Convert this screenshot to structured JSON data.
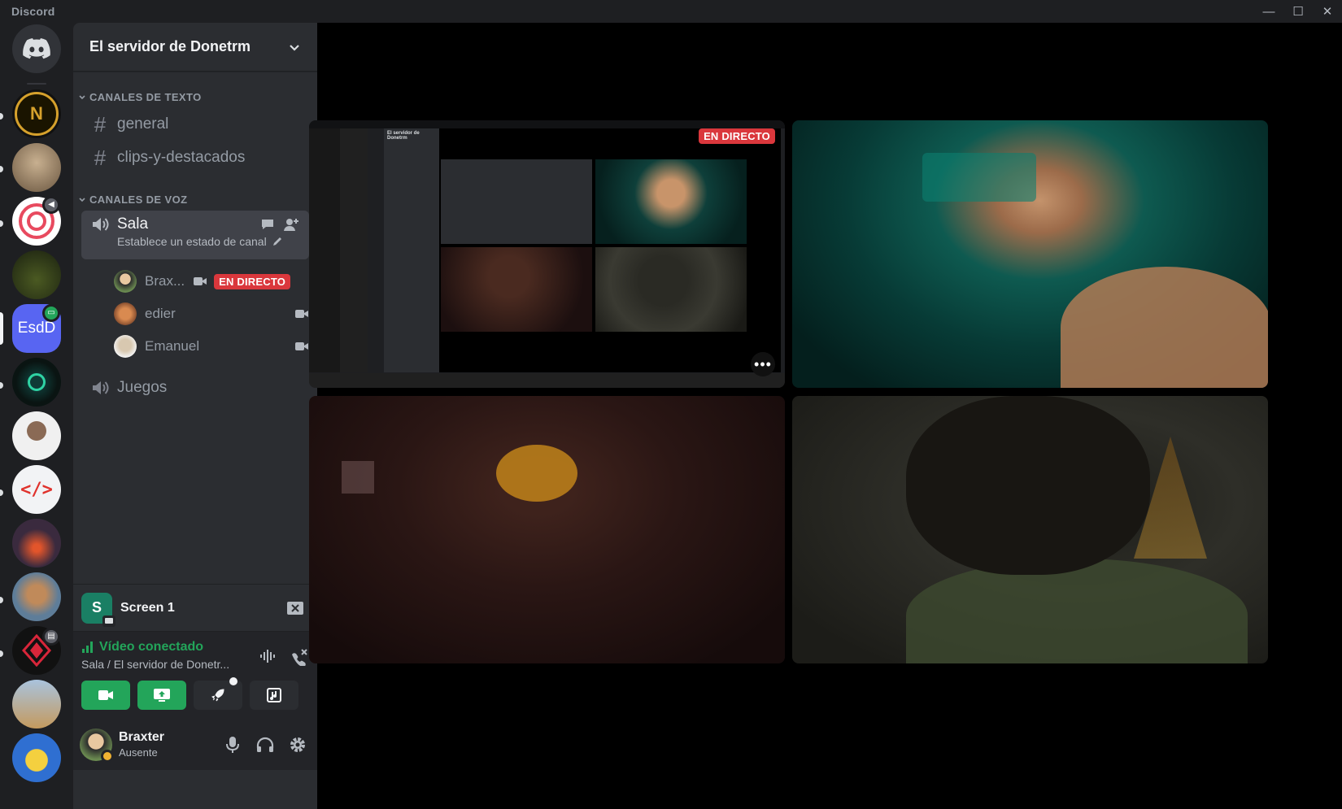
{
  "window": {
    "title": "Discord",
    "minimize": "—",
    "maximize": "☐",
    "close": "✕"
  },
  "rail": {
    "home": "discord-home",
    "servers": [
      {
        "name": "server-n-crest",
        "initial": "N",
        "color": "#1a1a1a",
        "accent": "#d6a12c"
      },
      {
        "name": "server-vintage-photo",
        "color": "#7a6a55"
      },
      {
        "name": "server-red-seal",
        "color": "#e84a5f"
      },
      {
        "name": "server-dark-forest",
        "color": "#2f3a1e"
      },
      {
        "name": "server-esdd",
        "initial": "EsdD",
        "color": "#5865f2"
      },
      {
        "name": "server-green-orb",
        "color": "#0b1a18"
      },
      {
        "name": "server-person",
        "color": "#dcdcdc"
      },
      {
        "name": "server-code",
        "initial": "</>",
        "color": "#f2f3f5",
        "accent": "#e0312b"
      },
      {
        "name": "server-fire",
        "color": "#3a2a3e"
      },
      {
        "name": "server-hog",
        "color": "#5e7d99"
      },
      {
        "name": "server-red-prism",
        "color": "#1a1a1a"
      },
      {
        "name": "server-dino",
        "color": "#6b7f9a"
      },
      {
        "name": "server-pikachu",
        "color": "#2f6fd1"
      }
    ]
  },
  "sidebar": {
    "server_name": "El servidor de Donetrm",
    "text_category": "CANALES DE TEXTO",
    "text_channels": [
      "general",
      "clips-y-destacados"
    ],
    "voice_category": "CANALES DE VOZ",
    "active_voice": {
      "name": "Sala",
      "status_placeholder": "Establece un estado de canal"
    },
    "voice_users": [
      {
        "name": "Brax...",
        "live": "EN DIRECTO"
      },
      {
        "name": "edier"
      },
      {
        "name": "Emanuel"
      }
    ],
    "other_voice": "Juegos"
  },
  "screen_panel": {
    "initial": "S",
    "label": "Screen 1"
  },
  "voice_panel": {
    "status": "Vídeo conectado",
    "location": "Sala / El servidor de Donetr..."
  },
  "user_panel": {
    "name": "Braxter",
    "status": "Ausente"
  },
  "stream": {
    "live_badge": "EN DIRECTO",
    "mini_server": "El servidor de Donetrm"
  },
  "colors": {
    "green": "#23a55a",
    "live_red": "#da373c",
    "blurple": "#5865f2",
    "teal": "#1a7f64"
  }
}
